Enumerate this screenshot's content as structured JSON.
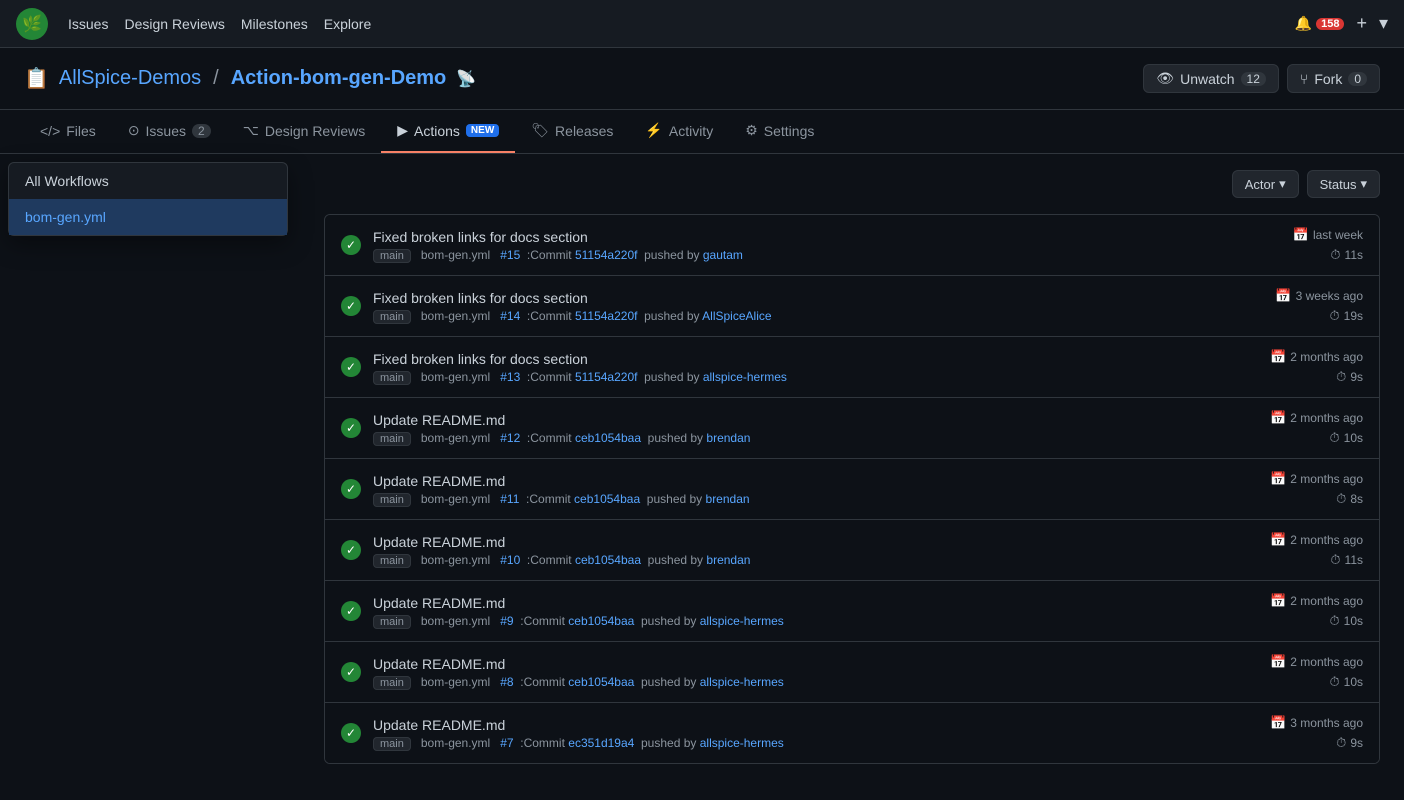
{
  "top_nav": {
    "logo": "🌿",
    "links": [
      "Issues",
      "Design Reviews",
      "Milestones",
      "Explore"
    ],
    "notification_count": "158",
    "plus_icon": "+",
    "arrow_icon": "▾"
  },
  "repo": {
    "icon": "📋",
    "org": "AllSpice-Demos",
    "separator": "/",
    "name": "Action-bom-gen-Demo",
    "rss_label": "RSS",
    "unwatch_label": "Unwatch",
    "unwatch_icon": "👁",
    "watch_count": "12",
    "fork_label": "Fork",
    "fork_icon": "⑂",
    "fork_count": "0"
  },
  "sub_nav": {
    "items": [
      {
        "key": "files",
        "icon": "</>",
        "label": "Files"
      },
      {
        "key": "issues",
        "icon": "⊙",
        "label": "Issues",
        "badge": "2"
      },
      {
        "key": "design-reviews",
        "icon": "⌥",
        "label": "Design Reviews"
      },
      {
        "key": "actions",
        "icon": "▶",
        "label": "Actions",
        "new_badge": "NEW",
        "active": true
      },
      {
        "key": "releases",
        "icon": "🏷",
        "label": "Releases"
      },
      {
        "key": "activity",
        "icon": "⚡",
        "label": "Activity"
      },
      {
        "key": "settings",
        "icon": "⚙",
        "label": "Settings"
      }
    ]
  },
  "sidebar": {
    "items": [
      {
        "key": "all-workflows",
        "label": "All Workflows"
      },
      {
        "key": "bom-gen",
        "label": "bom-gen.yml",
        "selected": true
      }
    ]
  },
  "filters": {
    "actor_label": "Actor",
    "status_label": "Status"
  },
  "runs": [
    {
      "title": "Fixed broken links for docs section",
      "branch": "main",
      "pr": "#15",
      "commit_prefix": "Commit",
      "commit_hash": "51154a220f",
      "pushed_by": "gautam",
      "date_label": "last week",
      "duration": "11s"
    },
    {
      "title": "Fixed broken links for docs section",
      "branch": "main",
      "pr": "#14",
      "commit_prefix": "Commit",
      "commit_hash": "51154a220f",
      "pushed_by": "AllSpiceAlice",
      "date_label": "3 weeks ago",
      "duration": "19s"
    },
    {
      "title": "Fixed broken links for docs section",
      "branch": "main",
      "pr": "#13",
      "commit_prefix": "Commit",
      "commit_hash": "51154a220f",
      "pushed_by": "allspice-hermes",
      "date_label": "2 months ago",
      "duration": "9s"
    },
    {
      "title": "Update README.md",
      "branch": "main",
      "pr": "#12",
      "commit_prefix": "Commit",
      "commit_hash": "ceb1054baa",
      "pushed_by": "brendan",
      "date_label": "2 months ago",
      "duration": "10s"
    },
    {
      "title": "Update README.md",
      "branch": "main",
      "pr": "#11",
      "commit_prefix": "Commit",
      "commit_hash": "ceb1054baa",
      "pushed_by": "brendan",
      "date_label": "2 months ago",
      "duration": "8s"
    },
    {
      "title": "Update README.md",
      "branch": "main",
      "pr": "#10",
      "commit_prefix": "Commit",
      "commit_hash": "ceb1054baa",
      "pushed_by": "brendan",
      "date_label": "2 months ago",
      "duration": "11s"
    },
    {
      "title": "Update README.md",
      "branch": "main",
      "pr": "#9",
      "commit_prefix": "Commit",
      "commit_hash": "ceb1054baa",
      "pushed_by": "allspice-hermes",
      "date_label": "2 months ago",
      "duration": "10s"
    },
    {
      "title": "Update README.md",
      "branch": "main",
      "pr": "#8",
      "commit_prefix": "Commit",
      "commit_hash": "ceb1054baa",
      "pushed_by": "allspice-hermes",
      "date_label": "2 months ago",
      "duration": "10s"
    },
    {
      "title": "Update README.md",
      "branch": "main",
      "pr": "#7",
      "commit_prefix": "Commit",
      "commit_hash": "ec351d19a4",
      "pushed_by": "allspice-hermes",
      "date_label": "3 months ago",
      "duration": "9s"
    }
  ]
}
